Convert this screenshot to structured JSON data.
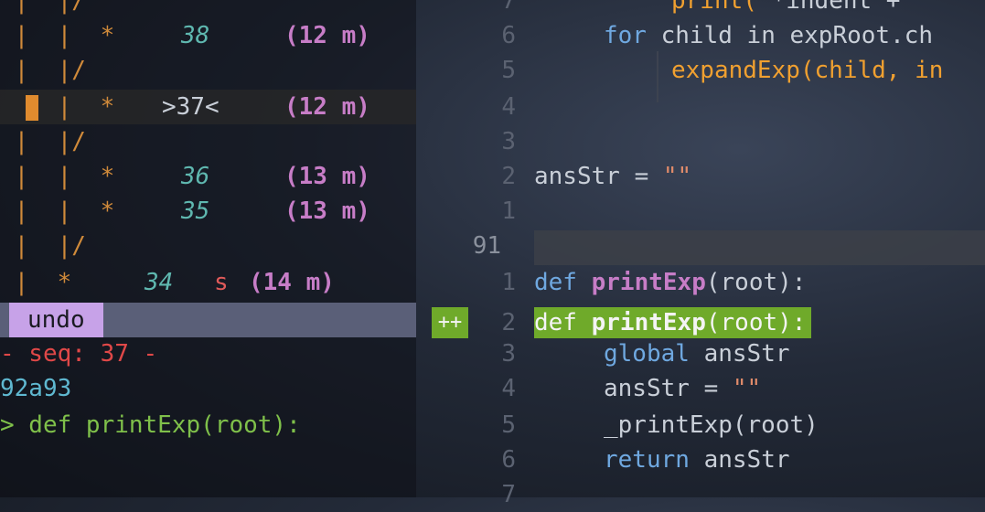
{
  "undo_tree": {
    "rows": [
      {
        "graph": " |  |/",
        "num": "",
        "smark": "",
        "time": ""
      },
      {
        "graph": " |  |  *",
        "num": "38",
        "smark": "",
        "time": "(12 m)"
      },
      {
        "graph": " |  |/",
        "num": "",
        "smark": "",
        "time": ""
      },
      {
        "graph": "    |  *",
        "num": ">37<",
        "smark": "",
        "time": "(12 m)",
        "current": true
      },
      {
        "graph": " |  |/",
        "num": "",
        "smark": "",
        "time": ""
      },
      {
        "graph": " |  |  *",
        "num": "36",
        "smark": "",
        "time": "(13 m)"
      },
      {
        "graph": " |  |  *",
        "num": "35",
        "smark": "",
        "time": "(13 m)"
      },
      {
        "graph": " |  |/",
        "num": "",
        "smark": "",
        "time": ""
      },
      {
        "graph": " |  *",
        "num": "34",
        "smark": "s",
        "time": "(14 m)"
      }
    ],
    "mode_label": "undo",
    "seq_line": "- seq: 37 -",
    "hash_line": "92a93",
    "diff_line": "> def printExp(root):"
  },
  "editor": {
    "relative_numbers": [
      "7",
      "6",
      "5",
      "4",
      "3",
      "2",
      "1",
      "91",
      "1",
      "2",
      "3",
      "4",
      "5",
      "6",
      "7"
    ],
    "current_line_number": "91",
    "added_marker": "++",
    "lines": {
      "l0_a": "print(",
      "l0_b": " *indent +",
      "l1_kw": "for",
      "l1_rest": " child in expRoot.ch",
      "l2": "expandExp(child, in",
      "l5_a": "ansStr = ",
      "l5_b": "\"\"",
      "l8_kw": "def",
      "l8_fn": "printExp",
      "l8_rest": "(root):",
      "l9_kw": "def",
      "l9_fn": "printExp",
      "l9_rest": "(root):",
      "l10_kw": "global",
      "l10_rest": " ansStr",
      "l11_a": "ansStr = ",
      "l11_b": "\"\"",
      "l12": "_printExp(root)",
      "l13_kw": "return",
      "l13_rest": " ansStr"
    }
  }
}
